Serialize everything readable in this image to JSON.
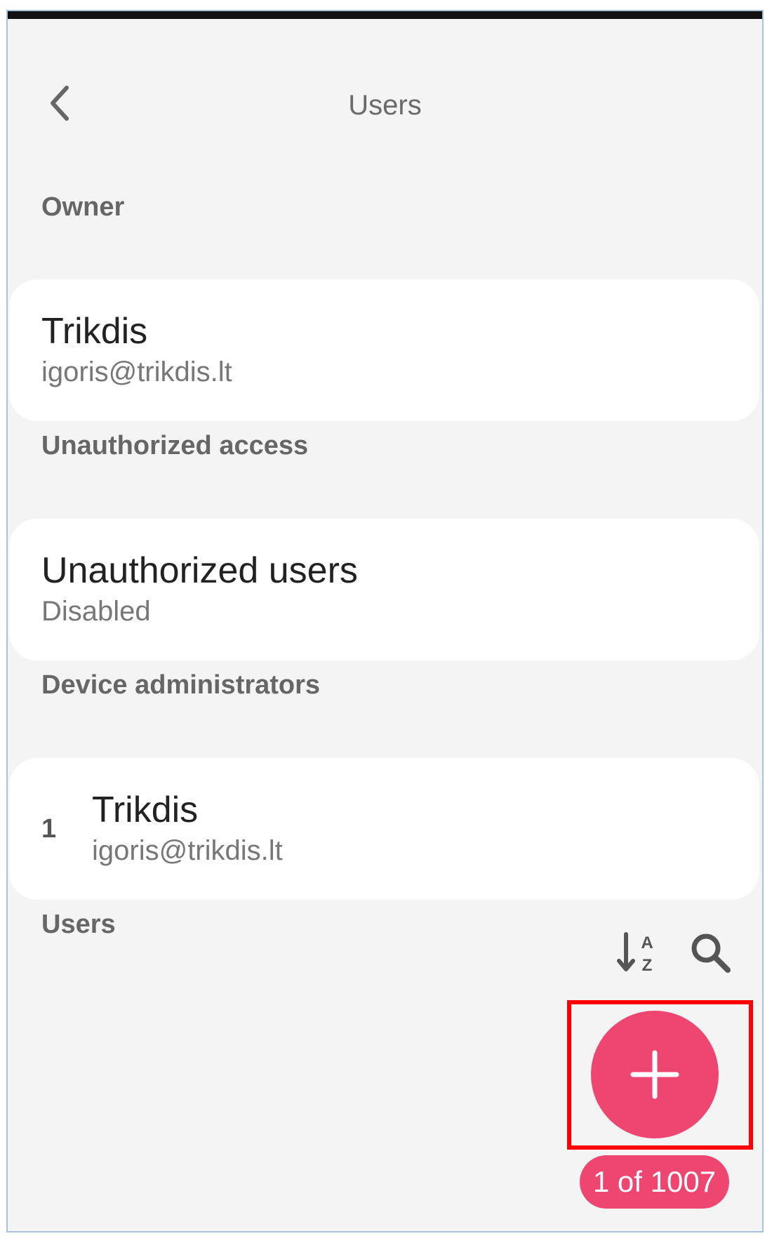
{
  "header": {
    "title": "Users",
    "back_icon": "chevron-left-icon"
  },
  "sections": {
    "owner": {
      "label": "Owner",
      "name": "Trikdis",
      "email": "igoris@trikdis.lt"
    },
    "unauthorized_access": {
      "label": "Unauthorized access",
      "title": "Unauthorized users",
      "status": "Disabled"
    },
    "device_administrators": {
      "label": "Device administrators",
      "items": [
        {
          "index": "1",
          "name": "Trikdis",
          "email": "igoris@trikdis.lt"
        }
      ]
    },
    "users": {
      "label": "Users",
      "sort_icon": "sort-alphabetical-icon",
      "search_icon": "search-icon"
    }
  },
  "fab": {
    "icon": "plus-icon",
    "color": "#ee4670"
  },
  "pagination": {
    "text": "1 of 1007"
  },
  "colors": {
    "background": "#f4f4f4",
    "card": "#ffffff",
    "accent": "#ee4670",
    "highlight": "#ff0000"
  }
}
